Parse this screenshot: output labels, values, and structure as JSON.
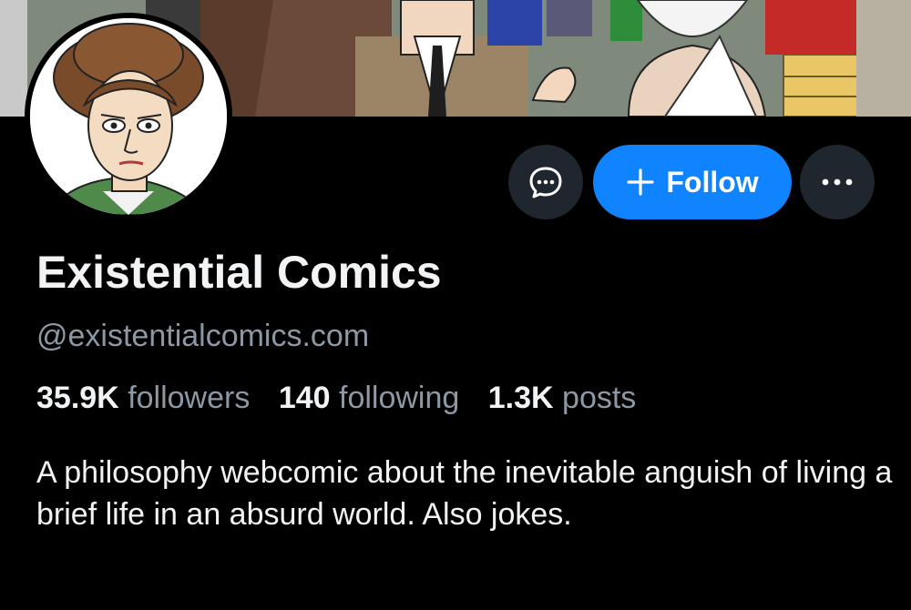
{
  "profile": {
    "display_name": "Existential Comics",
    "handle": "@existentialcomics.com",
    "bio": "A philosophy webcomic about the inevitable anguish of living a brief life in an absurd world. Also jokes.",
    "stats": {
      "followers_count": "35.9K",
      "followers_label": "followers",
      "following_count": "140",
      "following_label": "following",
      "posts_count": "1.3K",
      "posts_label": "posts"
    }
  },
  "actions": {
    "message_icon": "chat-bubble-icon",
    "follow_label": "Follow",
    "follow_icon": "plus-icon",
    "more_icon": "ellipsis-icon"
  },
  "colors": {
    "background": "#000000",
    "accent": "#1083fe",
    "muted_text": "#8d98a5",
    "button_bg": "#20262e"
  }
}
